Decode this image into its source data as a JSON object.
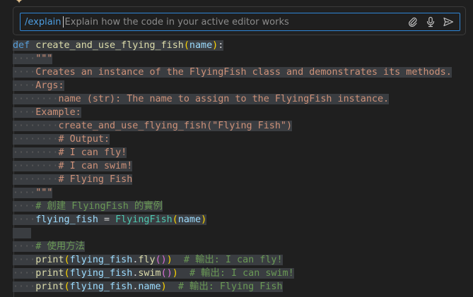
{
  "chat": {
    "command": "/explain",
    "placeholder": "Explain how the code in your active editor works",
    "attach_icon": "paperclip-icon",
    "mic_icon": "microphone-icon",
    "send_icon": "send-icon"
  },
  "code": {
    "lines": [
      "def create_and_use_flying_fish(name):",
      "    \"\"\"",
      "    Creates an instance of the FlyingFish class and demonstrates its methods.",
      "    Args:",
      "        name (str): The name to assign to the FlyingFish instance.",
      "    Example:",
      "        create_and_use_flying_fish(\"Flying Fish\")",
      "        # Output:",
      "        # I can fly!",
      "        # I can swim!",
      "        # Flying Fish",
      "    \"\"\"",
      "    # 創建 FlyingFish 的實例",
      "    flying_fish = FlyingFish(name)",
      "",
      "    # 使用方法",
      "    print(flying_fish.fly())  # 輸出: I can fly!",
      "    print(flying_fish.swim())  # 輸出: I can swim!",
      "    print(flying_fish.name)  # 輸出: Flying Fish"
    ]
  },
  "colors": {
    "accent": "#2f87d9",
    "keyword": "#569cd6",
    "function": "#dcdcaa",
    "string": "#ce9178",
    "comment": "#6a9955",
    "class": "#4ec9b0",
    "selection": "#3a3d41"
  }
}
